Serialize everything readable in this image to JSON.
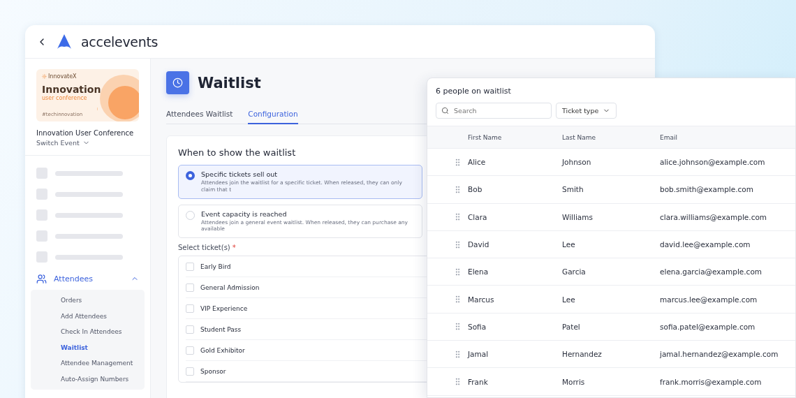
{
  "header": {
    "logo_text": "accelevents"
  },
  "event": {
    "banner": {
      "brand": "InnovateX",
      "title": "Innovation",
      "subtitle": "user conference",
      "hashtag": "#techinnovation"
    },
    "name": "Innovation User Conference",
    "switch_label": "Switch Event"
  },
  "sidebar": {
    "section": {
      "label": "Attendees",
      "expanded": true,
      "children": [
        {
          "label": "Orders",
          "selected": false
        },
        {
          "label": "Add Attendees",
          "selected": false
        },
        {
          "label": "Check In Attendees",
          "selected": false
        },
        {
          "label": "Waitlist",
          "selected": true
        },
        {
          "label": "Attendee Management",
          "selected": false
        },
        {
          "label": "Auto-Assign Numbers",
          "selected": false
        }
      ]
    }
  },
  "page": {
    "title": "Waitlist",
    "tabs": [
      {
        "label": "Attendees Waitlist",
        "selected": false
      },
      {
        "label": "Configuration",
        "selected": true
      }
    ],
    "card": {
      "heading": "When to show the waitlist",
      "options": [
        {
          "title": "Specific tickets sell out",
          "description": "Attendees join the waitlist for a specific ticket. When released, they can only claim that t",
          "selected": true
        },
        {
          "title": "Event capacity is reached",
          "description": "Attendees join a general event waitlist. When released, they can purchase any available",
          "selected": false
        }
      ],
      "tickets_label": "Select ticket(s)",
      "required_mark": "*",
      "tickets": [
        {
          "label": "Early Bird",
          "checked": false
        },
        {
          "label": "General Admission",
          "checked": false
        },
        {
          "label": "VIP Experience",
          "checked": false
        },
        {
          "label": "Student Pass",
          "checked": false
        },
        {
          "label": "Gold Exhibitor",
          "checked": false
        },
        {
          "label": "Sponsor",
          "checked": false
        }
      ]
    }
  },
  "panel": {
    "title": "6 people on waitlist",
    "search": {
      "placeholder": "Search"
    },
    "filter": "Ticket type",
    "columns": [
      "First Name",
      "Last Name",
      "Email"
    ],
    "rows": [
      [
        "Alice",
        "Johnson",
        "alice.johnson@example.com"
      ],
      [
        "Bob",
        "Smith",
        "bob.smith@example.com"
      ],
      [
        "Clara",
        "Williams",
        "clara.williams@example.com"
      ],
      [
        "David",
        "Lee",
        "david.lee@example.com"
      ],
      [
        "Elena",
        "Garcia",
        "elena.garcia@example.com"
      ],
      [
        "Marcus",
        "Lee",
        "marcus.lee@example.com"
      ],
      [
        "Sofia",
        "Patel",
        "sofia.patel@example.com"
      ],
      [
        "Jamal",
        "Hernandez",
        "jamal.hernandez@example.com"
      ],
      [
        "Frank",
        "Morris",
        "frank.morris@example.com"
      ]
    ]
  }
}
